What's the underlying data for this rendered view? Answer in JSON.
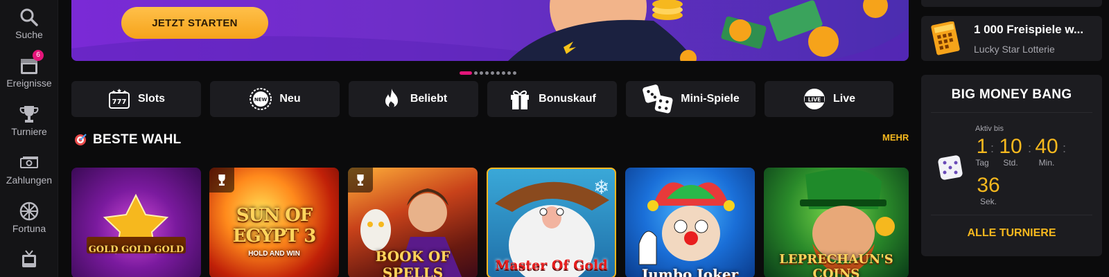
{
  "nav": {
    "items": [
      {
        "label": "Suche",
        "icon": "search-icon"
      },
      {
        "label": "Ereignisse",
        "icon": "calendar-icon",
        "badge": "6"
      },
      {
        "label": "Turniere",
        "icon": "trophy-icon"
      },
      {
        "label": "Zahlungen",
        "icon": "cash-icon"
      },
      {
        "label": "Fortuna",
        "icon": "wheel-icon"
      },
      {
        "label": "",
        "icon": "tv-icon"
      }
    ]
  },
  "hero": {
    "cta_label": "JETZT STARTEN",
    "slides_count": 9,
    "active_slide": 1
  },
  "categories": [
    {
      "label": "Slots",
      "icon": "slots-777-icon"
    },
    {
      "label": "Neu",
      "icon": "new-badge-icon"
    },
    {
      "label": "Beliebt",
      "icon": "flame-icon"
    },
    {
      "label": "Bonuskauf",
      "icon": "gift-icon"
    },
    {
      "label": "Mini-Spiele",
      "icon": "dice-icon"
    },
    {
      "label": "Live",
      "icon": "live-icon"
    }
  ],
  "section": {
    "title": "BESTE WAHL",
    "more_label": "MEHR"
  },
  "games": [
    {
      "title": "GOLD GOLD GOLD",
      "trophy": false
    },
    {
      "title": "SUN OF EGYPT 3",
      "subtitle": "HOLD AND WIN",
      "trophy": true
    },
    {
      "title": "BOOK OF SPELLS",
      "trophy": true
    },
    {
      "title": "Master Of Gold",
      "trophy": false
    },
    {
      "title": "Jumbo Joker",
      "trophy": false
    },
    {
      "title": "LEPRECHAUN'S COINS",
      "trophy": false
    }
  ],
  "promo": {
    "title": "1 000 Freispiele w...",
    "subtitle": "Lucky Star Lotterie"
  },
  "tournament": {
    "title": "BIG MONEY BANG",
    "active_label": "Aktiv bis",
    "days": "1",
    "days_unit": "Tag",
    "hours": "10",
    "hours_unit": "Std.",
    "minutes": "40",
    "minutes_unit": "Min.",
    "seconds": "36",
    "seconds_unit": "Sek.",
    "all_label": "ALLE TURNIERE"
  },
  "colors": {
    "accent": "#f6b81e",
    "badge": "#e3157a",
    "panel": "#1c1c20"
  }
}
